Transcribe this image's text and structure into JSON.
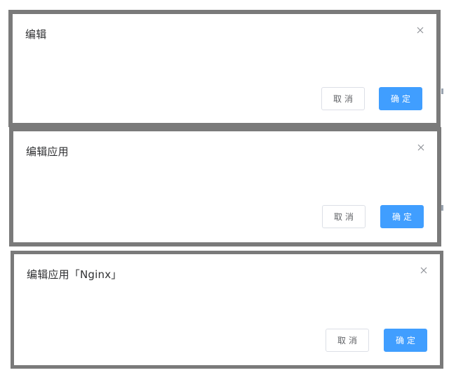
{
  "dialogs": [
    {
      "title": "编辑",
      "cancel_label": "取消",
      "confirm_label": "确定"
    },
    {
      "title": "编辑应用",
      "cancel_label": "取消",
      "confirm_label": "确定"
    },
    {
      "title": "编辑应用「Nginx」",
      "cancel_label": "取消",
      "confirm_label": "确定"
    }
  ],
  "colors": {
    "frame": "#7a7a7a",
    "primary": "#409eff",
    "title_text": "#303133",
    "cancel_border": "#dcdfe6"
  },
  "icons": [
    "close-icon"
  ]
}
